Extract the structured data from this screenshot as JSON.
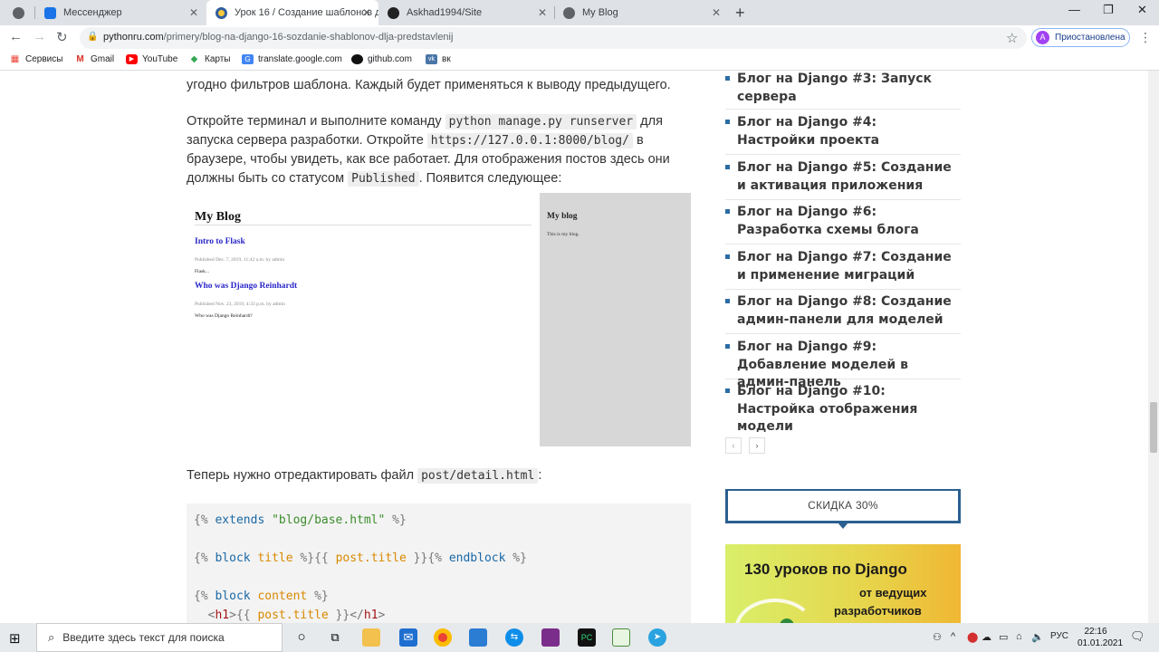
{
  "browser": {
    "tabs": [
      {
        "title": "",
        "icon": "globe-icon"
      },
      {
        "title": "Мессенджер",
        "icon": "messenger-icon"
      },
      {
        "title": "Урок 16 / Создание шаблонов д",
        "icon": "pythonru-icon",
        "active": true
      },
      {
        "title": "Askhad1994/Site",
        "icon": "github-icon"
      },
      {
        "title": "My Blog",
        "icon": "globe-icon"
      }
    ],
    "url_domain": "pythonru.com",
    "url_path": "/primery/blog-na-django-16-sozdanie-shablonov-dlja-predstavlenij",
    "profile_initial": "A",
    "profile_label": "Приостановлена",
    "bookmarks": [
      {
        "label": "Сервисы",
        "icon": "apps-icon",
        "color": "#ea4335"
      },
      {
        "label": "Gmail",
        "icon": "gmail-icon",
        "color": "#d93025"
      },
      {
        "label": "YouTube",
        "icon": "youtube-icon",
        "color": "#ff0000"
      },
      {
        "label": "Карты",
        "icon": "maps-icon",
        "color": "#34a853"
      },
      {
        "label": "translate.google.com",
        "icon": "translate-icon",
        "color": "#4285f4"
      },
      {
        "label": "github.com",
        "icon": "github-icon",
        "color": "#111111"
      },
      {
        "label": "вк",
        "icon": "vk-icon",
        "color": "#4a76a8"
      }
    ]
  },
  "article": {
    "p1": "угодно фильтров шаблона. Каждый будет применяться к выводу предыдущего.",
    "p2_a": "Откройте терминал и выполните команду ",
    "p2_code1": "python manage.py runserver",
    "p2_b": " для запуска сервера разработки. Откройте ",
    "p2_code2": "https://127.0.0.1:8000/blog/",
    "p2_c": " в браузере, чтобы увидеть, как все работает. Для отображения постов здесь они должны быть со статусом ",
    "p2_code3": "Published",
    "p2_d": ". Появится следующее:",
    "screenshot": {
      "title": "My Blog",
      "posts": [
        {
          "title": "Intro to Flask",
          "meta": "Published Dec. 7, 2019, 11:42 a.m. by admin",
          "body": "Flask..."
        },
        {
          "title": "Who was Django Reinhardt",
          "meta": "Published Nov. 23, 2019, 4:33 p.m. by admin",
          "body": "Who was Django Reinhardt?"
        }
      ],
      "side_title": "My blog",
      "side_text": "This is my blog."
    },
    "p3_a": "Теперь нужно отредактировать файл ",
    "p3_code": "post/detail.html",
    "p3_b": ":",
    "code": {
      "l1_open": "{% ",
      "l1_kw": "extends",
      "l1_str": " \"blog/base.html\"",
      "l1_close": " %}",
      "l2_open": "{% ",
      "l2_kw": "block",
      "l2_name": " title",
      "l2_mid": " %}{{ ",
      "l2_var": "post.title",
      "l2_mid2": " }}{% ",
      "l2_kw2": "endblock",
      "l2_close": " %}",
      "l3_open": "{% ",
      "l3_kw": "block",
      "l3_name": " content",
      "l3_close": " %}",
      "l4_indent": "  <",
      "l4_tag": "h1",
      "l4_mid": ">{{ ",
      "l4_var": "post.title",
      "l4_mid2": " }}</",
      "l4_tag2": "h1",
      "l4_end": ">"
    }
  },
  "sidebar": {
    "lessons": [
      "Блог на Django #3: Запуск сервера",
      "Блог на Django #4: Настройки проекта",
      "Блог на Django #5: Создание и активация приложения",
      "Блог на Django #6: Разработка схемы блога",
      "Блог на Django #7: Создание и применение миграций",
      "Блог на Django #8: Создание админ-панели для моделей",
      "Блог на Django #9: Добавление моделей в админ-панель",
      "Блог на Django #10: Настройка отображения модели"
    ],
    "prev": "‹",
    "next": "›",
    "discount": "СКИДКА 30%",
    "promo_line1": "130 уроков по Django",
    "promo_line2": "от ведущих",
    "promo_line3": "разработчиков"
  },
  "taskbar": {
    "search_placeholder": "Введите здесь текст для поиска",
    "lang": "РУС",
    "time": "22:16",
    "date": "01.01.2021"
  }
}
